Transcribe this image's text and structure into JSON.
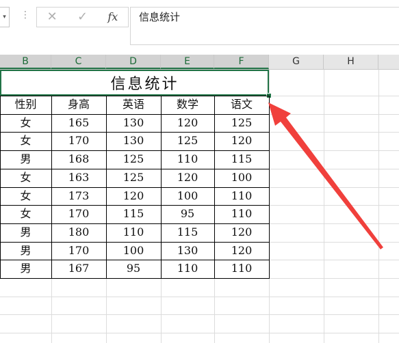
{
  "formula_bar": {
    "cancel_icon": "✕",
    "enter_icon": "✓",
    "fx_label": "fx",
    "content": "信息统计"
  },
  "columns": [
    "B",
    "C",
    "D",
    "E",
    "F",
    "G",
    "H"
  ],
  "table": {
    "title": "信息统计",
    "headers": [
      "性别",
      "身高",
      "英语",
      "数学",
      "语文"
    ],
    "rows": [
      [
        "女",
        "165",
        "130",
        "120",
        "125"
      ],
      [
        "女",
        "170",
        "130",
        "125",
        "120"
      ],
      [
        "男",
        "168",
        "125",
        "110",
        "115"
      ],
      [
        "女",
        "163",
        "125",
        "120",
        "100"
      ],
      [
        "女",
        "173",
        "120",
        "100",
        "110"
      ],
      [
        "女",
        "170",
        "115",
        "95",
        "110"
      ],
      [
        "男",
        "180",
        "110",
        "115",
        "120"
      ],
      [
        "男",
        "170",
        "100",
        "130",
        "120"
      ],
      [
        "男",
        "167",
        "95",
        "110",
        "110"
      ]
    ]
  },
  "annotation": {
    "arrow_color": "#f0403c"
  },
  "accent_color": "#217346"
}
